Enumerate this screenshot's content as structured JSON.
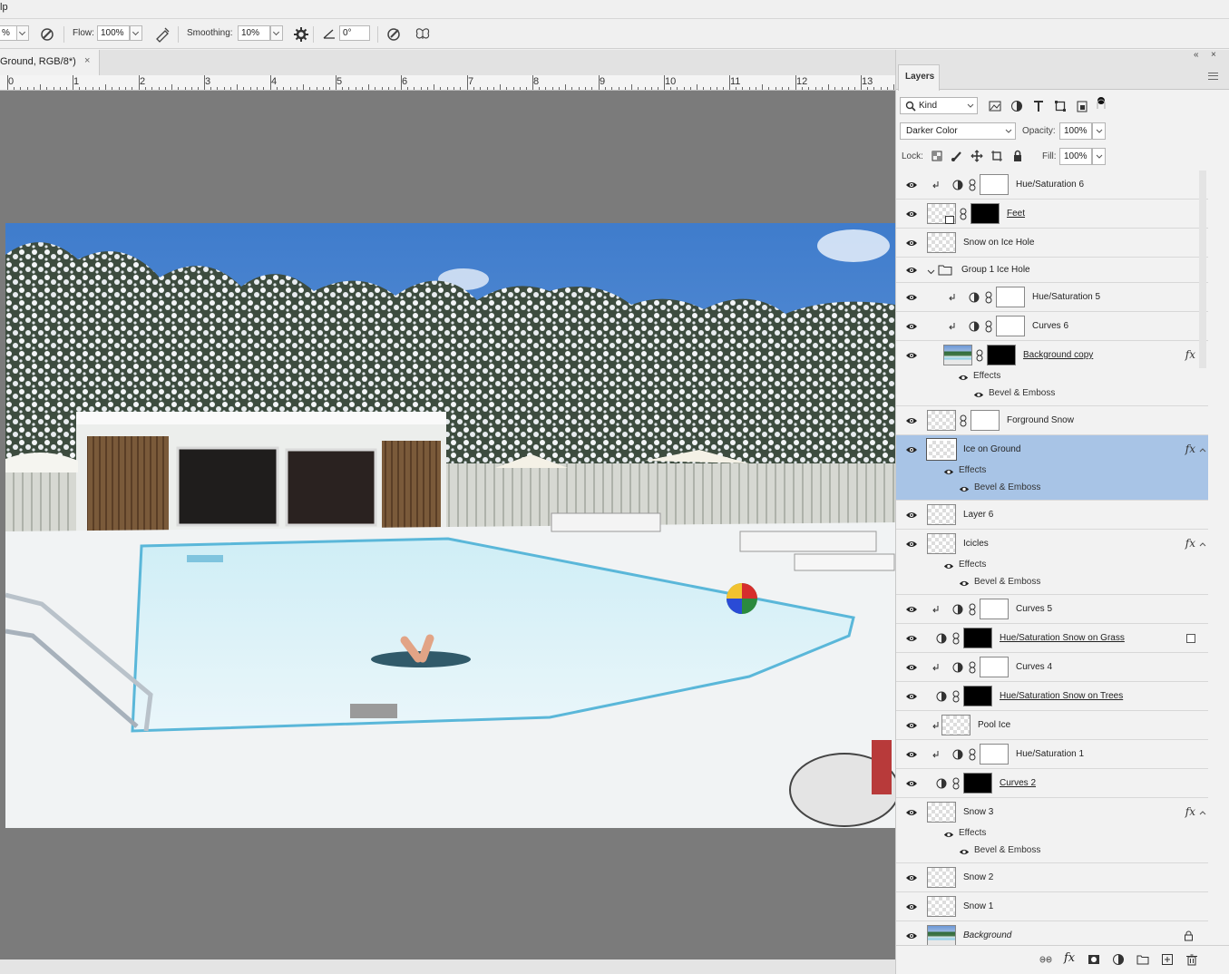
{
  "menu": {
    "partial_label": "lp"
  },
  "options_bar": {
    "brush_size_value": "%",
    "flow_label": "Flow:",
    "flow_value": "100%",
    "smoothing_label": "Smoothing:",
    "smoothing_value": "10%",
    "angle_value": "0°"
  },
  "document": {
    "tab_title": "Ground, RGB/8*)",
    "close_glyph": "×",
    "ruler_numbers": [
      "0",
      "1",
      "2",
      "3",
      "4",
      "5",
      "6",
      "7",
      "8",
      "9",
      "10",
      "11",
      "12",
      "13"
    ]
  },
  "panel": {
    "collapse_glyph": "«",
    "close_glyph": "×",
    "tab_label": "Layers",
    "filter_kind": "Kind",
    "blend_mode": "Darker Color",
    "opacity_label": "Opacity:",
    "opacity_value": "100%",
    "lock_label": "Lock:",
    "fill_label": "Fill:",
    "fill_value": "100%"
  },
  "layers": [
    {
      "name": "Hue/Saturation 6",
      "kind": "adjust",
      "clip": true,
      "mask": "white"
    },
    {
      "name": "Feet",
      "kind": "smart",
      "mask": "black",
      "underline": true
    },
    {
      "name": "Snow on Ice Hole",
      "kind": "pixel"
    },
    {
      "name": "Group 1 Ice Hole",
      "kind": "group"
    },
    {
      "name": "Hue/Saturation 5",
      "kind": "adjust",
      "clip": true,
      "mask": "white",
      "indent": true
    },
    {
      "name": "Curves 6",
      "kind": "adjust",
      "clip": true,
      "mask": "white",
      "indent": true
    },
    {
      "name": "Background copy",
      "kind": "photo",
      "mask": "black",
      "indent": true,
      "underline": true,
      "fx": true,
      "effects": [
        "Effects",
        "Bevel & Emboss"
      ]
    },
    {
      "name": "Forground Snow",
      "kind": "pixel",
      "mask": "white"
    },
    {
      "name": "Ice on Ground",
      "kind": "pixel",
      "selected": true,
      "fx": true,
      "effects": [
        "Effects",
        "Bevel & Emboss"
      ]
    },
    {
      "name": "Layer 6",
      "kind": "pixel"
    },
    {
      "name": "Icicles",
      "kind": "pixel",
      "fx": true,
      "effects": [
        "Effects",
        "Bevel & Emboss"
      ]
    },
    {
      "name": "Curves 5",
      "kind": "adjust",
      "clip": true,
      "mask": "white"
    },
    {
      "name": "Hue/Saturation Snow on Grass",
      "kind": "adjust",
      "mask": "black",
      "underline": true
    },
    {
      "name": "Curves 4",
      "kind": "adjust",
      "clip": true,
      "mask": "white"
    },
    {
      "name": "Hue/Saturation Snow on Trees",
      "kind": "adjust",
      "mask": "black",
      "underline": true
    },
    {
      "name": "Pool Ice",
      "kind": "pixel",
      "clip": true
    },
    {
      "name": "Hue/Saturation 1",
      "kind": "adjust",
      "clip": true,
      "mask": "white"
    },
    {
      "name": "Curves 2",
      "kind": "adjust",
      "mask": "black",
      "underline": true
    },
    {
      "name": "Snow 3",
      "kind": "pixel",
      "fx": true,
      "effects": [
        "Effects",
        "Bevel & Emboss"
      ]
    },
    {
      "name": "Snow 2",
      "kind": "pixel"
    },
    {
      "name": "Snow 1",
      "kind": "pixel"
    },
    {
      "name": "Background",
      "kind": "photo",
      "locked": true,
      "italic": true
    }
  ],
  "colors": {
    "canvas_bg": "#7b7b7b",
    "panel_bg": "#f2f2f2",
    "selected_layer": "#a8c4e6"
  }
}
